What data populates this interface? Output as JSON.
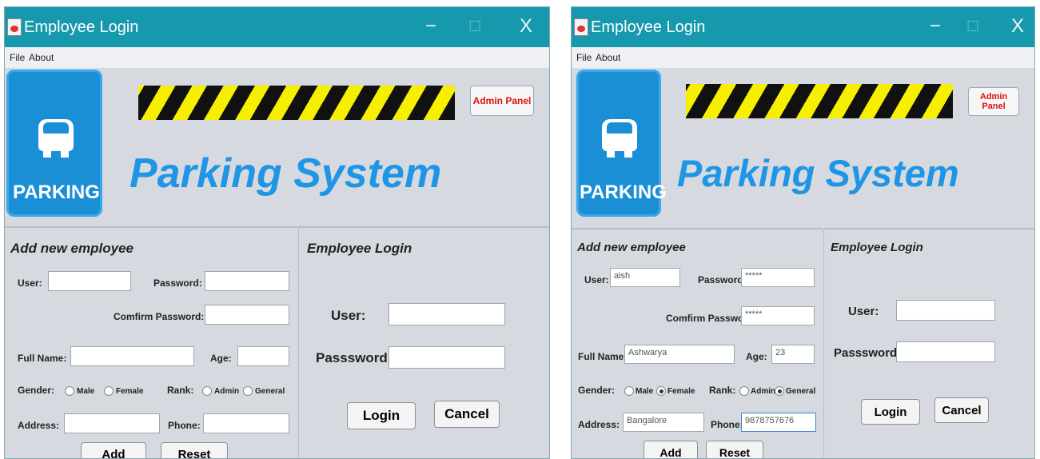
{
  "left": {
    "window": {
      "title": "Employee Login",
      "minimize": "−",
      "maximize": "☐",
      "close": "X"
    },
    "menu": {
      "file": "File",
      "about": "About"
    },
    "logo_text": "PARKING",
    "admin_button": "Admin Panel",
    "heading": "Parking System",
    "add_section": {
      "title": "Add new employee",
      "user_label": "User:",
      "password_label": "Password:",
      "confirm_label": "Comfirm Password:",
      "fullname_label": "Full Name:",
      "age_label": "Age:",
      "gender_label": "Gender:",
      "male": "Male",
      "female": "Female",
      "rank_label": "Rank:",
      "admin": "Admin",
      "general": "General",
      "address_label": "Address:",
      "phone_label": "Phone:",
      "add_button": "Add",
      "reset_button": "Reset",
      "values": {
        "user": "",
        "password": "",
        "confirm": "",
        "fullname": "",
        "age": "",
        "address": "",
        "phone": ""
      },
      "gender": "",
      "rank": ""
    },
    "login_section": {
      "title": "Employee Login",
      "user_label": "User:",
      "password_label": "Passsword:",
      "login_button": "Login",
      "cancel_button": "Cancel",
      "values": {
        "user": "",
        "password": ""
      }
    }
  },
  "right": {
    "window": {
      "title": "Employee Login",
      "minimize": "−",
      "maximize": "☐",
      "close": "X"
    },
    "menu": {
      "file": "File",
      "about": "About"
    },
    "logo_text": "PARKING",
    "admin_button": "Admin Panel",
    "heading": "Parking System",
    "add_section": {
      "title": "Add new employee",
      "user_label": "User:",
      "password_label": "Password:",
      "confirm_label": "Comfirm Password:",
      "fullname_label": "Full Name:",
      "age_label": "Age:",
      "gender_label": "Gender:",
      "male": "Male",
      "female": "Female",
      "rank_label": "Rank:",
      "admin": "Admin",
      "general": "General",
      "address_label": "Address:",
      "phone_label": "Phone:",
      "add_button": "Add",
      "reset_button": "Reset",
      "values": {
        "user": "aish",
        "password": "*****",
        "confirm": "*****",
        "fullname": "Ashwarya",
        "age": "23",
        "address": "Bangalore",
        "phone": "9878757676"
      },
      "gender": "Female",
      "rank": "General"
    },
    "login_section": {
      "title": "Employee Login",
      "user_label": "User:",
      "password_label": "Passsword:",
      "login_button": "Login",
      "cancel_button": "Cancel",
      "values": {
        "user": "",
        "password": ""
      }
    }
  }
}
